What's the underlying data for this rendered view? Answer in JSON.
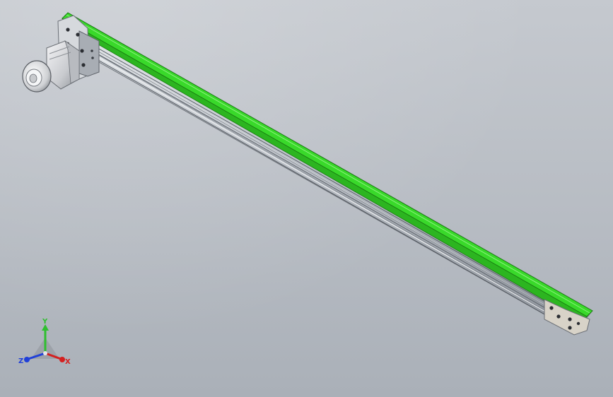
{
  "viewport": {
    "background_top": "#c5c9cf",
    "background_bottom": "#aab0b8"
  },
  "model": {
    "belt_color": "#39d92a",
    "frame_color": "#b9bec5",
    "motor_color": "#d9dadd",
    "plate_color": "#d8d3c8"
  },
  "triad": {
    "x_label": "X",
    "y_label": "Y",
    "z_label": "Z",
    "x_color": "#d42020",
    "y_color": "#2fbf2f",
    "z_color": "#2040d8"
  }
}
